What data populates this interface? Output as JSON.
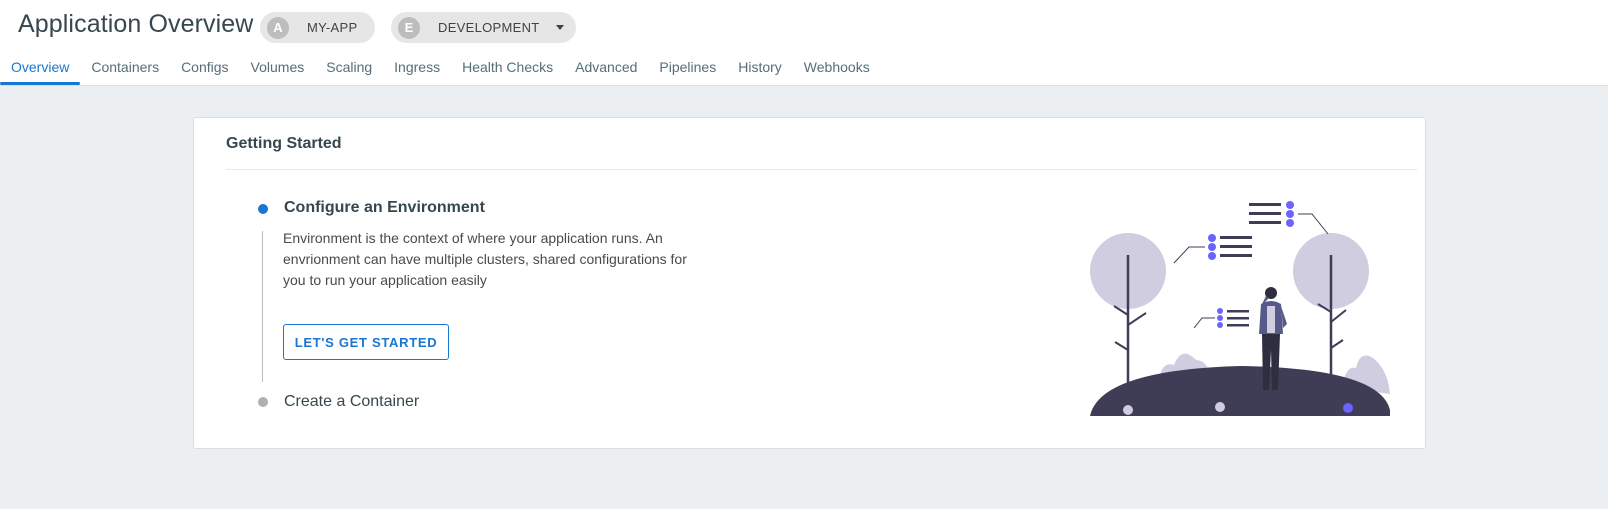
{
  "header": {
    "title": "Application Overview",
    "app_chip": {
      "avatar": "A",
      "label": "MY-APP"
    },
    "env_chip": {
      "avatar": "E",
      "label": "DEVELOPMENT",
      "icon": "chevron-down-icon"
    }
  },
  "tabs": [
    {
      "label": "Overview",
      "active": true
    },
    {
      "label": "Containers",
      "active": false
    },
    {
      "label": "Configs",
      "active": false
    },
    {
      "label": "Volumes",
      "active": false
    },
    {
      "label": "Scaling",
      "active": false
    },
    {
      "label": "Ingress",
      "active": false
    },
    {
      "label": "Health Checks",
      "active": false
    },
    {
      "label": "Advanced",
      "active": false
    },
    {
      "label": "Pipelines",
      "active": false
    },
    {
      "label": "History",
      "active": false
    },
    {
      "label": "Webhooks",
      "active": false
    }
  ],
  "card": {
    "title": "Getting Started",
    "steps": [
      {
        "title": "Configure an Environment",
        "description": "Environment is the context of where your application runs. An envrionment can have multiple clusters, shared configurations for you to run your application easily",
        "button": "LET'S GET STARTED",
        "state": "active"
      },
      {
        "title": "Create a Container",
        "state": "pending"
      }
    ]
  },
  "colors": {
    "accent": "#1976d2",
    "background": "#eceff1",
    "illustration_light": "#d0cde1",
    "illustration_dark": "#3f3d56",
    "illustration_accent": "#6c63ff"
  }
}
